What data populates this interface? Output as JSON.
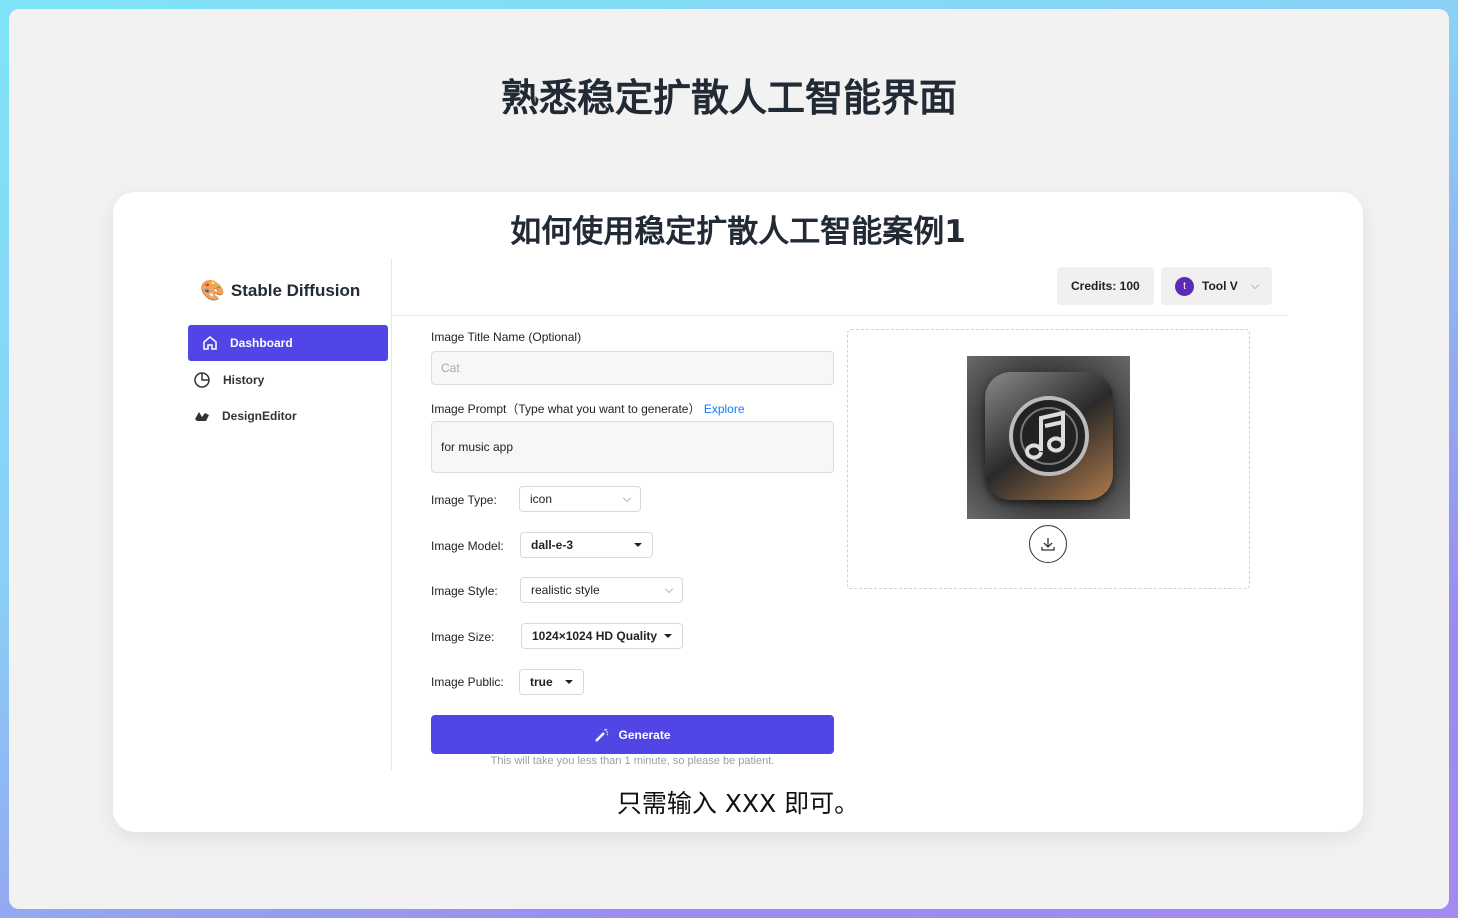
{
  "page": {
    "title": "熟悉稳定扩散人工智能界面",
    "subtitle": "如何使用稳定扩散人工智能案例1",
    "footer": "只需输入 XXX 即可。"
  },
  "app": {
    "brand": "Stable Diffusion",
    "sidebar": {
      "items": [
        {
          "label": "Dashboard",
          "icon": "home-icon",
          "active": true
        },
        {
          "label": "History",
          "icon": "pie-chart-icon"
        },
        {
          "label": "DesignEditor",
          "icon": "shapes-icon"
        }
      ]
    },
    "header": {
      "credits": "Credits: 100",
      "user": {
        "initial": "t",
        "name": "Tool V"
      }
    },
    "form": {
      "title_label": "Image Title Name (Optional)",
      "title_placeholder": "Cat",
      "prompt_label": "Image Prompt（Type what you want to generate）",
      "explore": "Explore",
      "prompt_value": "for music app",
      "type_label": "Image Type:",
      "type_value": "icon",
      "model_label": "Image Model:",
      "model_value": "dall-e-3",
      "style_label": "Image Style:",
      "style_value": "realistic style",
      "size_label": "Image Size:",
      "size_value": "1024×1024 HD Quality",
      "public_label": "Image Public:",
      "public_value": "true",
      "generate": "Generate",
      "note": "This will take you less than 1 minute, so please be patient."
    },
    "colors": {
      "accent": "#4f46e5",
      "avatar": "#5b2bb5",
      "link": "#1677ff"
    }
  }
}
